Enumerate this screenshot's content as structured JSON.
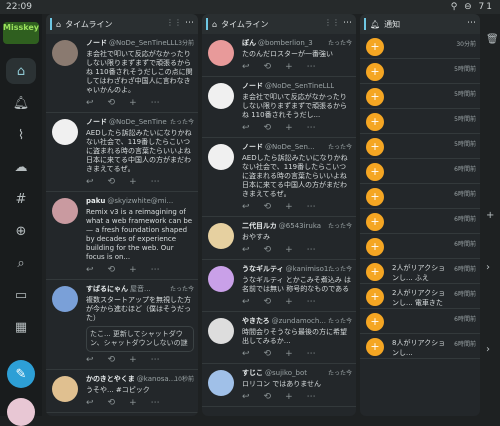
{
  "status": {
    "time": "22:09",
    "icons": "⚲ ⊖ 71"
  },
  "logo": "Misskey",
  "columns": [
    {
      "title": "タイムライン",
      "notes": [
        {
          "name": "ノード",
          "acct": "@NoDe_SenTineLLL",
          "time": "3分前",
          "body": "ま会社で叩いて反応がなかったりしない限りまずまずで頑張るからね 110番されそうだしこの点に関してはわざわざ中国人に言わなきゃいかんのよ。",
          "color": "#8a7a70"
        },
        {
          "name": "ノード",
          "acct": "@NoDe_SenTine",
          "time": "たった今",
          "body": "AEDしたら訴訟みたいになりかねない社会で、119番したらこいつに盗まれる時の言葉たらいいよね 日本に来てる中国人の方がまだわきまえてるぜ。",
          "color": "#f0f0f0"
        },
        {
          "name": "paku",
          "acct": "@skyizwhite@mi...",
          "time": "",
          "body": "Remix v3 is a reimagining of what a web framework can be — a fresh foundation shaped by decades of experience building for the web. Our focus is on...",
          "color": "#c99aa0"
        },
        {
          "name": "すばるにゃん",
          "acct": "屋音...",
          "time": "たった今",
          "body": "複数スタートアップを無視した方が今から進むほど（僕はそうだった）",
          "color": "#7aa0d8",
          "quote": "たこ... 更新してシャットダウン、シャットダウンしないの謎"
        },
        {
          "name": "かのきとやくま",
          "acct": "@kanosa...",
          "time": "10秒前",
          "body": "うそや... #コピック",
          "color": "#e0c090"
        }
      ]
    },
    {
      "title": "タイムライン",
      "notes": [
        {
          "name": "ぽん",
          "acct": "@bomberlion_3",
          "time": "たった今",
          "body": "たのんだロスターが一番強い",
          "color": "#e89a9a"
        },
        {
          "name": "ノード",
          "acct": "@NoDe_SenTineLLL",
          "time": "",
          "body": "ま会社で叩いて反応がなかったりしない限りまずまずで頑張るからね 110番されそうだし...",
          "color": "#f0f0f0"
        },
        {
          "name": "ノード",
          "acct": "@NoDe_Sen...",
          "time": "たった今",
          "body": "AEDしたら訴訟みたいになりかねない社会で、119番したらこいつに盗まれる時の言葉たらいいよね 日本に来てる中国人の方がまだわきまえてるぜ。",
          "color": "#f0f0f0"
        },
        {
          "name": "二代目ルカ",
          "acct": "@6543iruka",
          "time": "たった今",
          "body": "おやすみ",
          "color": "#e6d0a0"
        },
        {
          "name": "うなギルティ",
          "acct": "@kanimiso1...",
          "time": "たった今",
          "body": "うなギルティ とかこみそ煮込み は名前では無い 称号的なものである",
          "color": "#c9a0e8"
        },
        {
          "name": "やきたろ",
          "acct": "@zundamoch...",
          "time": "たった今",
          "body": "時間会りそうなら最後の方に希望出してみるか…",
          "color": "#ddd"
        },
        {
          "name": "すじこ",
          "acct": "@sujiko_bot",
          "time": "たった今",
          "body": "ロリコン ではありません",
          "color": "#a0c0e8"
        }
      ]
    },
    {
      "title": "通知",
      "notifs": [
        {
          "time": "30分前",
          "text": ""
        },
        {
          "time": "5時間前",
          "text": ""
        },
        {
          "time": "5時間前",
          "text": ""
        },
        {
          "time": "5時間前",
          "text": ""
        },
        {
          "time": "5時間前",
          "text": ""
        },
        {
          "time": "6時間前",
          "text": ""
        },
        {
          "time": "6時間前",
          "text": ""
        },
        {
          "time": "6時間前",
          "text": ""
        },
        {
          "time": "6時間前",
          "text": ""
        },
        {
          "time": "6時間前",
          "text": "2人がリアクションし... ふえ"
        },
        {
          "time": "6時間前",
          "text": "2人がリアクションし... 電車きた"
        },
        {
          "time": "6時間前",
          "text": ""
        },
        {
          "time": "6時間前",
          "text": "8人がリアクションし..."
        }
      ]
    }
  ]
}
